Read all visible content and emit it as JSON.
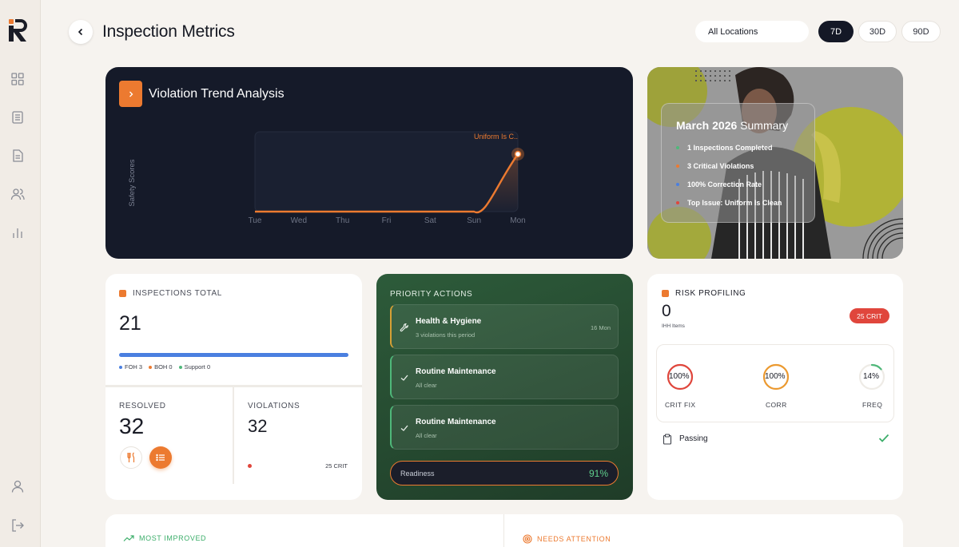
{
  "header": {
    "title": "Inspection Metrics",
    "location": "All Locations",
    "ranges": [
      "7D",
      "30D",
      "90D"
    ],
    "active_range": "7D"
  },
  "trend": {
    "title": "Violation Trend Analysis",
    "ylabel": "Safety Scores",
    "annotation": "Uniform Is C.."
  },
  "chart_data": {
    "type": "line",
    "categories": [
      "Tue",
      "Wed",
      "Thu",
      "Fri",
      "Sat",
      "Sun",
      "Mon"
    ],
    "values": [
      0,
      0,
      0,
      0,
      0,
      0,
      1
    ],
    "ylabel": "Safety Scores",
    "annotations": [
      {
        "x": "Mon",
        "text": "Uniform Is C.."
      }
    ]
  },
  "summary": {
    "title_bold": "March 2026",
    "title_rest": "Summary",
    "items": [
      {
        "text": "1 Inspections Completed",
        "color": "#4fb87a"
      },
      {
        "text": "3 Critical Violations",
        "color": "#ec7a30"
      },
      {
        "text": "100% Correction Rate",
        "color": "#4a7fe0"
      },
      {
        "text": "Top Issue: Uniform Is Clean",
        "color": "#e0463c"
      }
    ]
  },
  "inspections": {
    "label": "INSPECTIONS TOTAL",
    "total": "21",
    "progress_fraction": 1.0,
    "legend": [
      {
        "text": "FOH 3",
        "color": "#4a7fe0"
      },
      {
        "text": "BOH 0",
        "color": "#ec7a30"
      },
      {
        "text": "Support 0",
        "color": "#4fb87a"
      }
    ],
    "resolved_label": "RESOLVED",
    "resolved_value": "32",
    "violations_label": "VIOLATIONS",
    "violations_value": "32",
    "violations_crit": "25 CRIT"
  },
  "priority": {
    "title": "PRIORITY ACTIONS",
    "items": [
      {
        "name": "Health & Hygiene",
        "desc": "3 violations this period",
        "date": "16 Mon",
        "icon": "wrench-icon"
      },
      {
        "name": "Routine Maintenance",
        "desc": "All clear",
        "icon": "check-icon"
      },
      {
        "name": "Routine Maintenance",
        "desc": "All clear",
        "icon": "check-icon"
      }
    ],
    "readiness_label": "Readiness",
    "readiness_value": "91%"
  },
  "risk": {
    "title": "RISK PROFILING",
    "value": "0",
    "sub": "IHH Items",
    "badge": "25 CRIT",
    "metrics": [
      {
        "label": "CRIT FIX",
        "value": "100%",
        "fraction": 1.0,
        "color": "#e0463c"
      },
      {
        "label": "CORR",
        "value": "100%",
        "fraction": 1.0,
        "color": "#ec9a30"
      },
      {
        "label": "FREQ",
        "value": "14%",
        "fraction": 0.14,
        "color": "#4fb87a"
      }
    ],
    "passing_label": "Passing"
  },
  "bottom": {
    "left_label": "MOST IMPROVED",
    "right_label": "NEEDS ATTENTION"
  }
}
